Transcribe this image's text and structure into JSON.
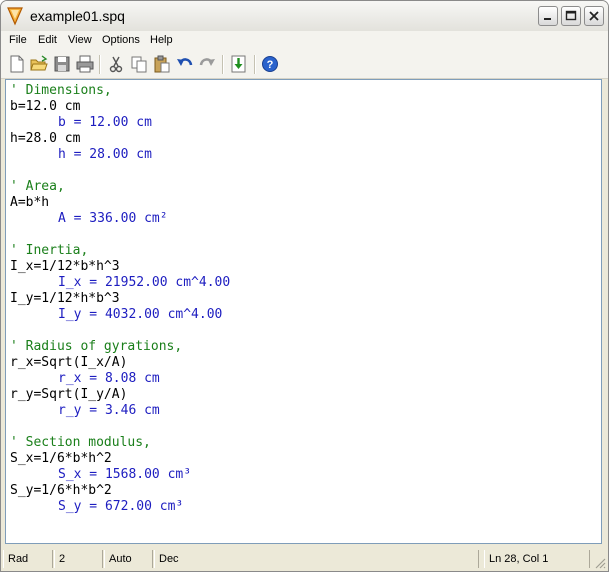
{
  "window": {
    "title": "example01.spq",
    "app_icon": "spq-app-icon"
  },
  "menu": {
    "items": [
      "File",
      "Edit",
      "View",
      "Options",
      "Help"
    ]
  },
  "toolbar": {
    "buttons": [
      "new-file-icon",
      "open-folder-icon",
      "save-icon",
      "print-icon",
      "cut-icon",
      "copy-icon",
      "paste-icon",
      "undo-icon",
      "redo-icon",
      "calculate-icon",
      "help-icon"
    ]
  },
  "editor": {
    "lines": [
      {
        "kind": "comment",
        "text": "' Dimensions,"
      },
      {
        "kind": "input",
        "text": "b=12.0 cm"
      },
      {
        "kind": "result",
        "text": "b = 12.00 cm"
      },
      {
        "kind": "input",
        "text": "h=28.0 cm"
      },
      {
        "kind": "result",
        "text": "h = 28.00 cm"
      },
      {
        "kind": "blank",
        "text": ""
      },
      {
        "kind": "comment",
        "text": "' Area,"
      },
      {
        "kind": "input",
        "text": "A=b*h"
      },
      {
        "kind": "result",
        "text": "A = 336.00 cm²"
      },
      {
        "kind": "blank",
        "text": ""
      },
      {
        "kind": "comment",
        "text": "' Inertia,"
      },
      {
        "kind": "input",
        "text": "I_x=1/12*b*h^3"
      },
      {
        "kind": "result",
        "text": "I_x = 21952.00 cm^4.00"
      },
      {
        "kind": "input",
        "text": "I_y=1/12*h*b^3"
      },
      {
        "kind": "result",
        "text": "I_y = 4032.00 cm^4.00"
      },
      {
        "kind": "blank",
        "text": ""
      },
      {
        "kind": "comment",
        "text": "' Radius of gyrations,"
      },
      {
        "kind": "input",
        "text": "r_x=Sqrt(I_x/A)"
      },
      {
        "kind": "result",
        "text": "r_x = 8.08 cm"
      },
      {
        "kind": "input",
        "text": "r_y=Sqrt(I_y/A)"
      },
      {
        "kind": "result",
        "text": "r_y = 3.46 cm"
      },
      {
        "kind": "blank",
        "text": ""
      },
      {
        "kind": "comment",
        "text": "' Section modulus,"
      },
      {
        "kind": "input",
        "text": "S_x=1/6*b*h^2"
      },
      {
        "kind": "result",
        "text": "S_x = 1568.00 cm³"
      },
      {
        "kind": "input",
        "text": "S_y=1/6*h*b^2"
      },
      {
        "kind": "result",
        "text": "S_y = 672.00 cm³"
      }
    ]
  },
  "status": {
    "angle_mode": "Rad",
    "decimals": "2",
    "format": "Auto",
    "base": "Dec",
    "position": "Ln 28, Col 1"
  },
  "colors": {
    "comment": "#1a7f1a",
    "result": "#1d1dc0",
    "input": "#000000"
  }
}
